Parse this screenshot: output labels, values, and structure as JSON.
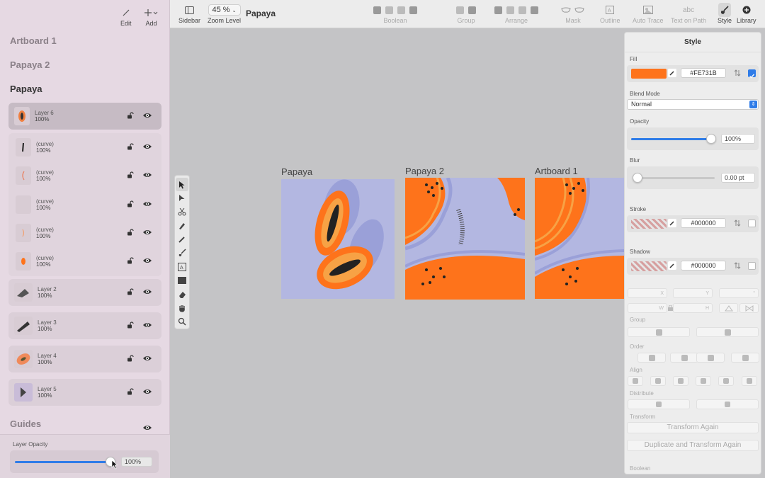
{
  "sidebar": {
    "edit_label": "Edit",
    "add_label": "Add",
    "artboards": [
      "Artboard 1",
      "Papaya 2",
      "Papaya"
    ],
    "layers": [
      {
        "name": "Layer 6",
        "opacity": "100%"
      },
      {
        "name": "(curve)",
        "opacity": "100%"
      },
      {
        "name": "(curve)",
        "opacity": "100%"
      },
      {
        "name": "(curve)",
        "opacity": "100%"
      },
      {
        "name": "(curve)",
        "opacity": "100%"
      },
      {
        "name": "(curve)",
        "opacity": "100%"
      },
      {
        "name": "Layer 2",
        "opacity": "100%"
      },
      {
        "name": "Layer 3",
        "opacity": "100%"
      },
      {
        "name": "Layer 4",
        "opacity": "100%"
      },
      {
        "name": "Layer 5",
        "opacity": "100%"
      }
    ],
    "guides_label": "Guides",
    "layer_opacity_label": "Layer Opacity",
    "layer_opacity_value": "100%",
    "layer_opacity_fraction": 1.0
  },
  "toolbar": {
    "sidebar_label": "Sidebar",
    "zoom_value": "45 %",
    "zoom_label": "Zoom Level",
    "document_title": "Papaya",
    "boolean_label": "Boolean",
    "group_label": "Group",
    "arrange_label": "Arrange",
    "mask_label": "Mask",
    "outline_label": "Outline",
    "auto_trace_label": "Auto Trace",
    "text_on_path_label": "Text on Path",
    "text_on_path_glyph": "abc",
    "style_label": "Style",
    "library_label": "Library"
  },
  "canvas": {
    "artboards": [
      {
        "title": "Papaya"
      },
      {
        "title": "Papaya 2"
      },
      {
        "title": "Artboard 1"
      }
    ]
  },
  "style_panel": {
    "title": "Style",
    "fill_label": "Fill",
    "fill_hex": "#FE731B",
    "fill_color": "#FE731B",
    "blend_mode_label": "Blend Mode",
    "blend_mode_value": "Normal",
    "opacity_label": "Opacity",
    "opacity_value": "100%",
    "opacity_fraction": 1.0,
    "blur_label": "Blur",
    "blur_value": "0.00 pt",
    "stroke_label": "Stroke",
    "stroke_hex": "#000000",
    "shadow_label": "Shadow",
    "shadow_hex": "#000000",
    "x_label": "X",
    "y_label": "Y",
    "angle_label": "°",
    "w_label": "W",
    "h_label": "H",
    "group_label": "Group",
    "order_label": "Order",
    "align_label": "Align",
    "distribute_label": "Distribute",
    "transform_label": "Transform",
    "transform_again_label": "Transform Again",
    "duplicate_transform_label": "Duplicate and Transform Again",
    "boolean_label": "Boolean"
  },
  "colors": {
    "accent": "#2F7CE8",
    "papaya_orange": "#FE731B",
    "lavender": "#B3B7E1"
  }
}
